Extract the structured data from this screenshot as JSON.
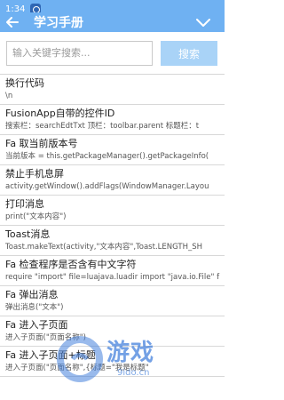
{
  "status": {
    "time": "1:34"
  },
  "header": {
    "title": "学习手册"
  },
  "search": {
    "placeholder": "输入关键字搜索...",
    "button_label": "搜索"
  },
  "items": [
    {
      "title": "换行代码",
      "code": "\\n"
    },
    {
      "title": "FusionApp自带的控件ID",
      "code": "搜索栏：searchEdtTxt 顶栏：toolbar.parent 标题栏：t"
    },
    {
      "title": "Fa 取当前版本号",
      "code": "当前版本 = this.getPackageManager().getPackageInfo("
    },
    {
      "title": "禁止手机息屏",
      "code": "activity.getWindow().addFlags(WindowManager.Layou"
    },
    {
      "title": "打印消息",
      "code": "print(\"文本内容\")"
    },
    {
      "title": "Toast消息",
      "code": "Toast.makeText(activity,\"文本内容\",Toast.LENGTH_SH"
    },
    {
      "title": "Fa 检查程序是否含有中文字符",
      "code": "require \"import\" file=luajava.luadir import \"java.io.File\" f"
    },
    {
      "title": "Fa 弹出消息",
      "code": "弹出消息(\"文本\")"
    },
    {
      "title": "Fa 进入子页面",
      "code": "进入子页面(\"页面名称\")"
    },
    {
      "title": "Fa 进入子页面+标题",
      "code": "进入子页面(\"页面名称\",{标题=\"我是标题\""
    }
  ],
  "watermark": {
    "text": "游戏",
    "url": "9ido.cn"
  },
  "colors": {
    "primary": "#6fb1f2",
    "button": "#a9d3f7",
    "divider": "#d8d8d8"
  },
  "icons": {
    "back": "arrow-left-icon",
    "menu": "chevron-down-icon",
    "status": "notification-icon"
  }
}
